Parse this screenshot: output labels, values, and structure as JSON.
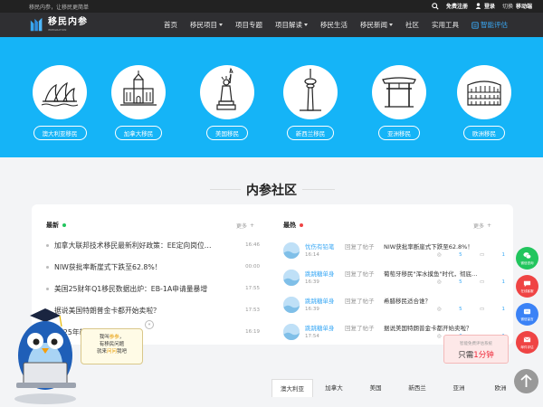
{
  "topbar": {
    "slogan": "移民内参，让移民更简单",
    "register": "免费注册",
    "login": "登录",
    "switch_prefix": "切换",
    "switch_label": "移动端"
  },
  "logo": {
    "main": "移民内参",
    "sub": "IMMIGRATION"
  },
  "nav": {
    "items": [
      {
        "label": "首页",
        "caret": false
      },
      {
        "label": "移民项目",
        "caret": true
      },
      {
        "label": "项目专题",
        "caret": false
      },
      {
        "label": "项目解读",
        "caret": true
      },
      {
        "label": "移民生活",
        "caret": false
      },
      {
        "label": "移民新闻",
        "caret": true
      },
      {
        "label": "社区",
        "caret": false
      },
      {
        "label": "实用工具",
        "caret": false
      }
    ],
    "smart": "智能评估"
  },
  "categories": [
    {
      "label": "澳大利亚移民",
      "icon": "sydney-opera-house-icon"
    },
    {
      "label": "加拿大移民",
      "icon": "canada-parliament-icon"
    },
    {
      "label": "美国移民",
      "icon": "statue-of-liberty-icon"
    },
    {
      "label": "新西兰移民",
      "icon": "sky-tower-icon"
    },
    {
      "label": "亚洲移民",
      "icon": "torii-gate-icon"
    },
    {
      "label": "欧洲移民",
      "icon": "colosseum-icon"
    }
  ],
  "section_title": "内参社区",
  "latest": {
    "title": "最新",
    "more": "更多",
    "dot_color": "#22c55e",
    "items": [
      {
        "title": "加拿大联邦技术移民最新利好政策：EE定向岗位…",
        "time": "16:46"
      },
      {
        "title": "NIW获批率断崖式下跌至62.8%！",
        "time": "00:00"
      },
      {
        "title": "美国25财年Q1移民数据出炉：EB-1A申请量暴增",
        "time": "17:55"
      },
      {
        "title": "据说美国特朗普金卡都开始卖啦？",
        "time": "17:53"
      },
      {
        "title": "2025年新…最新移民排期",
        "time": "16:19"
      }
    ]
  },
  "hot": {
    "title": "最热",
    "more": "更多",
    "dot_color": "#ef4444",
    "items": [
      {
        "user": "忧伤有铅笔",
        "action": "回复了帖子",
        "title": "NIW获批率断崖式下跌至62.8%！",
        "time": "16:14",
        "views": "5",
        "comments": "1"
      },
      {
        "user": "跳跳糖单身",
        "action": "回复了帖子",
        "title": "葡萄牙移民\"浑水摸鱼\"时代，彻底…",
        "time": "16:39",
        "views": "5",
        "comments": "1"
      },
      {
        "user": "跳跳糖单身",
        "action": "回复了帖子",
        "title": "希腊移民适合谁？",
        "time": "16:39",
        "views": "5",
        "comments": "1"
      },
      {
        "user": "跳跳糖单身",
        "action": "回复了帖子",
        "title": "据说美国特朗普金卡都开始卖啦？",
        "time": "17:54",
        "views": "0",
        "comments": "1"
      }
    ]
  },
  "tabs": [
    "澳大利亚",
    "加拿大",
    "美国",
    "新西兰",
    "亚洲",
    "欧洲"
  ],
  "float_buttons": [
    {
      "label": "微信咨询",
      "color": "#22c55e",
      "icon": "wechat-icon"
    },
    {
      "label": "在线客服",
      "color": "#ef4444",
      "icon": "chat-icon"
    },
    {
      "label": "微信留言",
      "color": "#3b82f6",
      "icon": "message-icon"
    },
    {
      "label": "邮件评估",
      "color": "#ef4444",
      "icon": "mail-icon"
    }
  ],
  "promo": {
    "line1": "智能免费评估系统",
    "line2_prefix": "只需",
    "line2_highlight": "1分钟"
  },
  "bubble": {
    "l1_pre": "我叫",
    "l1_hl": "参参",
    "l1_post": "，",
    "l2": "有移民问题",
    "l3_pre": "就来",
    "l3_hl": "问问",
    "l3_post": "我吧"
  },
  "collapse_glyph": "«"
}
